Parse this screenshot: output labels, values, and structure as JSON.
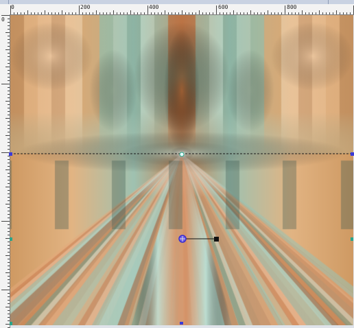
{
  "ruler": {
    "labels": [
      "0",
      "200",
      "400",
      "600",
      "800"
    ]
  },
  "colors": {
    "ruler_bg": "#f3f3f3",
    "guide_line": "#1a1a1a",
    "handle_blue": "#3b3bd8",
    "handle_teal": "#2aa58a",
    "center_handle": "#3a2ecf",
    "end_handle": "#111111"
  },
  "icons": {
    "center": "crosshair-circle-icon",
    "end": "square-handle-icon"
  }
}
